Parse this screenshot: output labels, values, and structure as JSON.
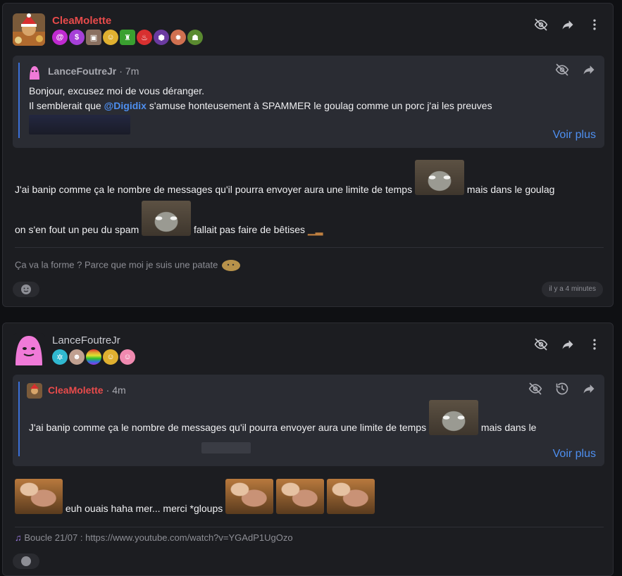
{
  "colors": {
    "accent": "#4e8ff0",
    "author_red": "#e84b4b",
    "author_gray": "#c9cad0",
    "quote_bar": "#3a6fd8"
  },
  "posts": [
    {
      "author": "CleaMolette",
      "badges": [
        "spiral-badge",
        "dollar-badge",
        "cube-badge",
        "smiley-badge",
        "crest-badge",
        "cola-badge",
        "hex-badge",
        "sun-badge",
        "robot-badge"
      ],
      "quote": {
        "author": "LanceFoutreJr",
        "time": "7m",
        "line1": "Bonjour, excusez moi de vous déranger.",
        "line2_before": "Il semblerait que ",
        "line2_mention": "@Digidix",
        "line2_after": " s'amuse honteusement à SPAMMER le goulag comme un porc j'ai les preuves",
        "voir_plus": "Voir plus"
      },
      "body_line1_a": "J'ai banip comme ça le nombre de messages qu'il pourra envoyer aura une limite de temps ",
      "body_line1_b": " mais dans le goulag",
      "body_line2_a": "on s'en fout un peu du spam ",
      "body_line2_b": " fallait pas faire de bêtises",
      "signature": "Ça va la forme ? Parce que moi je suis une patate",
      "timestamp": "il y a 4 minutes"
    },
    {
      "author": "LanceFoutreJr",
      "badges": [
        "cyan-badge",
        "face-badge",
        "rainbow-badge",
        "smiley-badge",
        "pink-badge"
      ],
      "quote": {
        "author": "CleaMolette",
        "time": "4m",
        "text_a": "J'ai banip comme ça le nombre de messages qu'il pourra envoyer aura une limite de temps ",
        "text_b": " mais dans le",
        "voir_plus": "Voir plus"
      },
      "body_text": " euh ouais haha mer... merci *gloups ",
      "signature": "Boucle 21/07 : https://www.youtube.com/watch?v=YGAdP1UgOzo"
    }
  ]
}
